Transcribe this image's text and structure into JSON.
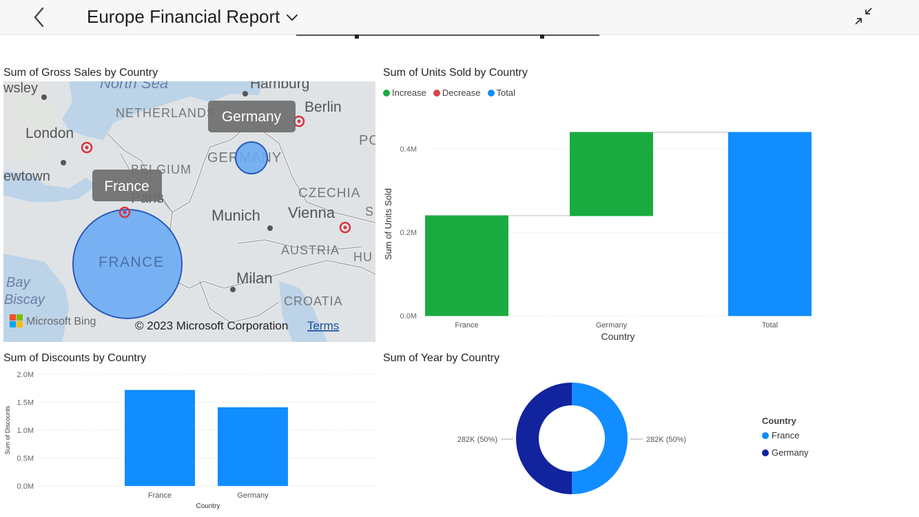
{
  "header": {
    "back_icon": "chevron-left-icon",
    "title": "Europe Financial Report",
    "title_dropdown_icon": "chevron-down-icon",
    "exit_focus_icon": "collapse-arrows-icon"
  },
  "colors": {
    "increase": "#1aab40",
    "decrease": "#d64550",
    "total": "#118dff",
    "france_donut": "#118dff",
    "germany_donut": "#12239e",
    "map_bubble": "#6aaaf5"
  },
  "map_visual": {
    "title": "Sum of Gross Sales by Country",
    "labels": {
      "north_sea": "North Sea",
      "hamburg": "Hamburg",
      "berlin": "Berlin",
      "netherlands": "NETHERLANDS",
      "london": "London",
      "owsley": "wsley",
      "newtown": "ewtown",
      "belgium": "BELGIUM",
      "paris": "Paris",
      "germany_region": "GERMANY",
      "czechia": "CZECHIA",
      "po": "PO",
      "munich": "Munich",
      "vienna": "Vienna",
      "s": "S",
      "austria": "AUSTRIA",
      "hu": "HU",
      "france_region": "FRANCE",
      "milan": "Milan",
      "croatia": "CROATIA",
      "bay": "Bay",
      "biscay": "Biscay"
    },
    "tooltip_germany": "Germany",
    "tooltip_france": "France",
    "bing_logo_text": "Microsoft Bing",
    "copyright": "© 2023 Microsoft Corporation",
    "terms_link": "Terms"
  },
  "units_visual": {
    "title": "Sum of Units Sold by Country",
    "legend": [
      {
        "label": "Increase",
        "color": "#1aab40"
      },
      {
        "label": "Decrease",
        "color": "#d64550"
      },
      {
        "label": "Total",
        "color": "#118dff"
      }
    ]
  },
  "discounts_visual": {
    "title": "Sum of Discounts by Country"
  },
  "year_visual": {
    "title": "Sum of Year by Country",
    "legend_title": "Country",
    "legend": [
      {
        "label": "France",
        "color": "#118dff"
      },
      {
        "label": "Germany",
        "color": "#12239e"
      }
    ]
  },
  "chart_data": [
    {
      "type": "bar",
      "subtype": "waterfall",
      "title": "Sum of Units Sold by Country",
      "categories": [
        "France",
        "Germany",
        "Total"
      ],
      "series": [
        {
          "name": "Increase",
          "values": [
            0.24,
            0.2,
            null
          ]
        },
        {
          "name": "Total",
          "values": [
            null,
            null,
            0.44
          ]
        }
      ],
      "xlabel": "Country",
      "ylabel": "Sum of Units Sold",
      "yticks": [
        "0.0M",
        "0.2M",
        "0.4M"
      ],
      "ylim": [
        0,
        0.44
      ],
      "legend_position": "top-left",
      "grid": true
    },
    {
      "type": "bar",
      "title": "Sum of Discounts by Country",
      "categories": [
        "France",
        "Germany"
      ],
      "values": [
        1.72,
        1.41
      ],
      "xlabel": "Country",
      "ylabel": "Sum of Discounts",
      "yticks": [
        "0.0M",
        "0.5M",
        "1.0M",
        "1.5M",
        "2.0M"
      ],
      "ylim": [
        0,
        2.0
      ],
      "grid": true
    },
    {
      "type": "pie",
      "subtype": "donut",
      "title": "Sum of Year by Country",
      "categories": [
        "France",
        "Germany"
      ],
      "values": [
        282,
        282
      ],
      "data_labels": [
        "282K (50%)",
        "282K (50%)"
      ],
      "legend_title": "Country",
      "legend_position": "right"
    }
  ]
}
